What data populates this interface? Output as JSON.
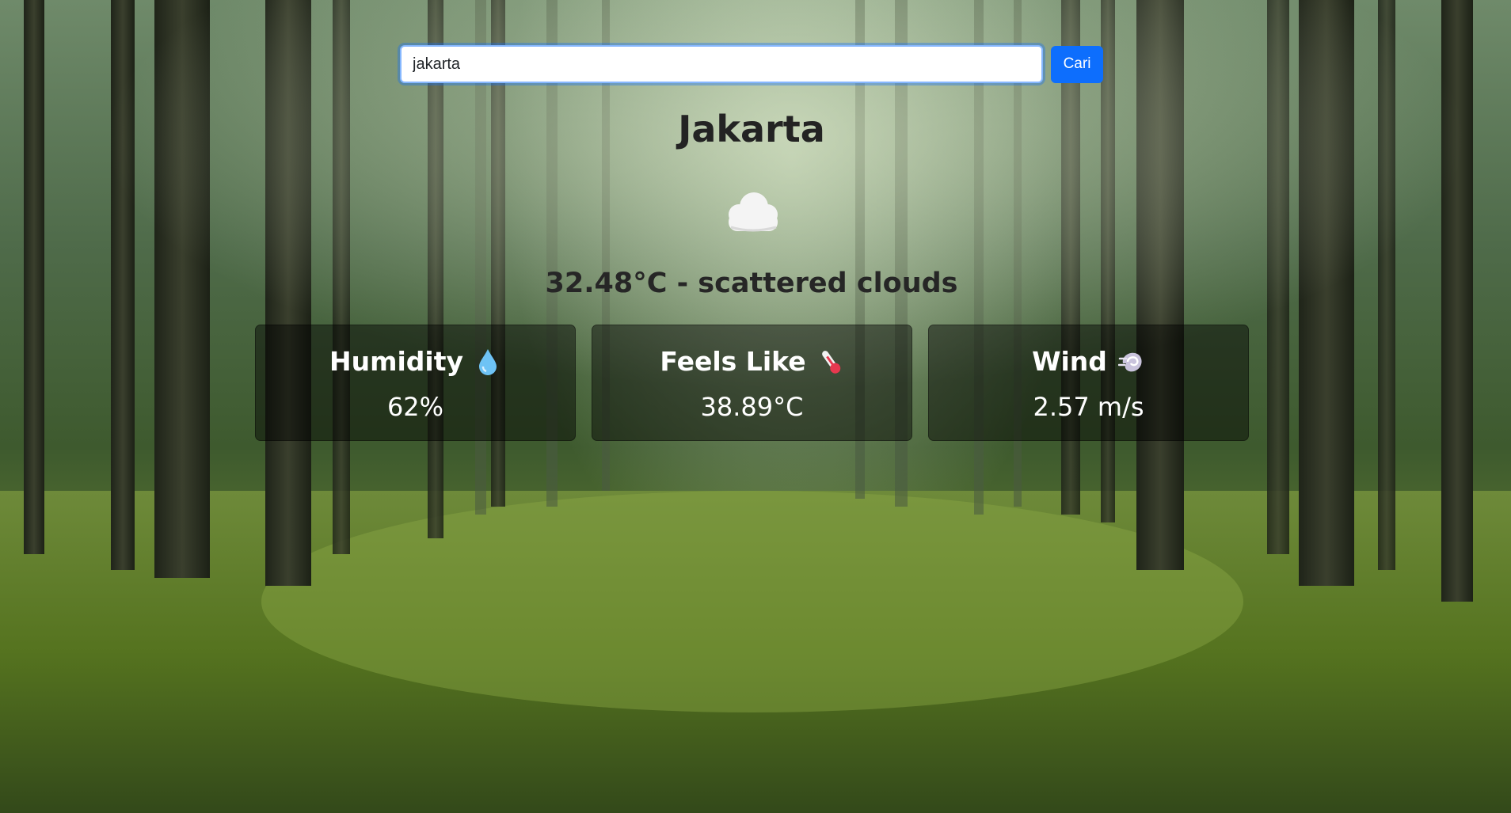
{
  "search": {
    "value": "jakarta",
    "button_label": "Cari"
  },
  "weather": {
    "city": "Jakarta",
    "icon": "cloud-icon",
    "summary": "32.48°C - scattered clouds"
  },
  "cards": [
    {
      "title": "Humidity",
      "icon": "water-drop-icon",
      "value": "62%"
    },
    {
      "title": "Feels Like",
      "icon": "thermometer-icon",
      "value": "38.89°C"
    },
    {
      "title": "Wind",
      "icon": "wind-icon",
      "value": "2.57 m/s"
    }
  ],
  "colors": {
    "accent": "#0d6efd",
    "card_background": "rgba(0,0,0,0.45)",
    "heading_text": "#232323"
  }
}
